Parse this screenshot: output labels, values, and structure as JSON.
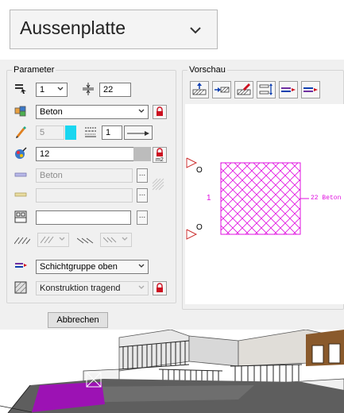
{
  "top_select": {
    "value": "Aussenplatte"
  },
  "parameter": {
    "legend": "Parameter",
    "layer_select": "1",
    "thickness_value": "22",
    "material_value": "Beton",
    "pen_value": "5",
    "linetype_value": "1",
    "fill_value": "12",
    "surface_value": "Beton",
    "hatch_value": "",
    "pattern_value": "",
    "layer_group_select": "Schichtgruppe oben",
    "construction_select": "Konstruktion tragend"
  },
  "preview": {
    "legend": "Vorschau",
    "left_label": "1",
    "right_label": "22 Beton"
  },
  "buttons": {
    "cancel_label": "Abbrechen"
  },
  "colors": {
    "preview_hatch": "#e010e0",
    "pen_color": "#19d6f0",
    "lock_red": "#cc1020",
    "scene_slab": "#9c12b4"
  }
}
